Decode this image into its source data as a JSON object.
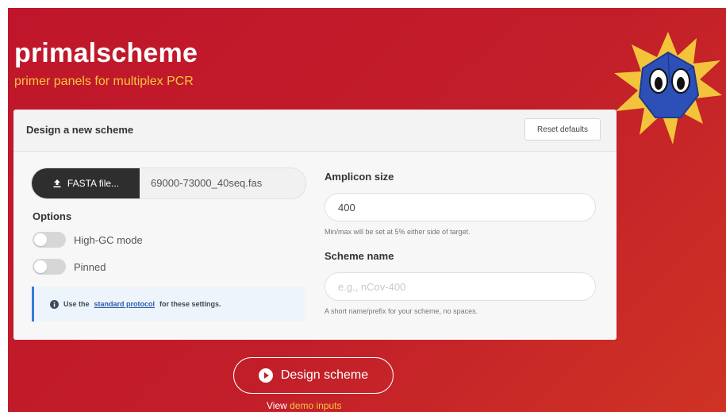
{
  "app": {
    "title": "primalscheme",
    "subtitle": "primer panels for multiplex PCR"
  },
  "card": {
    "title": "Design a new scheme",
    "reset_label": "Reset defaults"
  },
  "file": {
    "button_label": "FASTA file...",
    "filename": "69000-73000_40seq.fas",
    "icon": "upload-icon"
  },
  "options": {
    "label": "Options",
    "toggles": [
      {
        "label": "High-GC mode",
        "on": false
      },
      {
        "label": "Pinned",
        "on": false
      }
    ]
  },
  "note": {
    "prefix": "Use the",
    "link": "standard protocol",
    "suffix": "for these settings.",
    "icon": "info-icon"
  },
  "amplicon": {
    "label": "Amplicon size",
    "value": "400",
    "help": "Min/max will be set at 5% either side of target."
  },
  "scheme_name": {
    "label": "Scheme name",
    "placeholder": "e.g., nCov-400",
    "value": "",
    "help": "A short name/prefix for your scheme, no spaces."
  },
  "actions": {
    "design_label": "Design scheme",
    "design_icon": "play-circle-icon",
    "demo_prefix": "View",
    "demo_link": "demo inputs"
  },
  "colors": {
    "background": "#c21e2a",
    "accent": "#f7c63a",
    "mascot_body": "#2d4fb8",
    "mascot_spikes": "#f3c43b"
  }
}
